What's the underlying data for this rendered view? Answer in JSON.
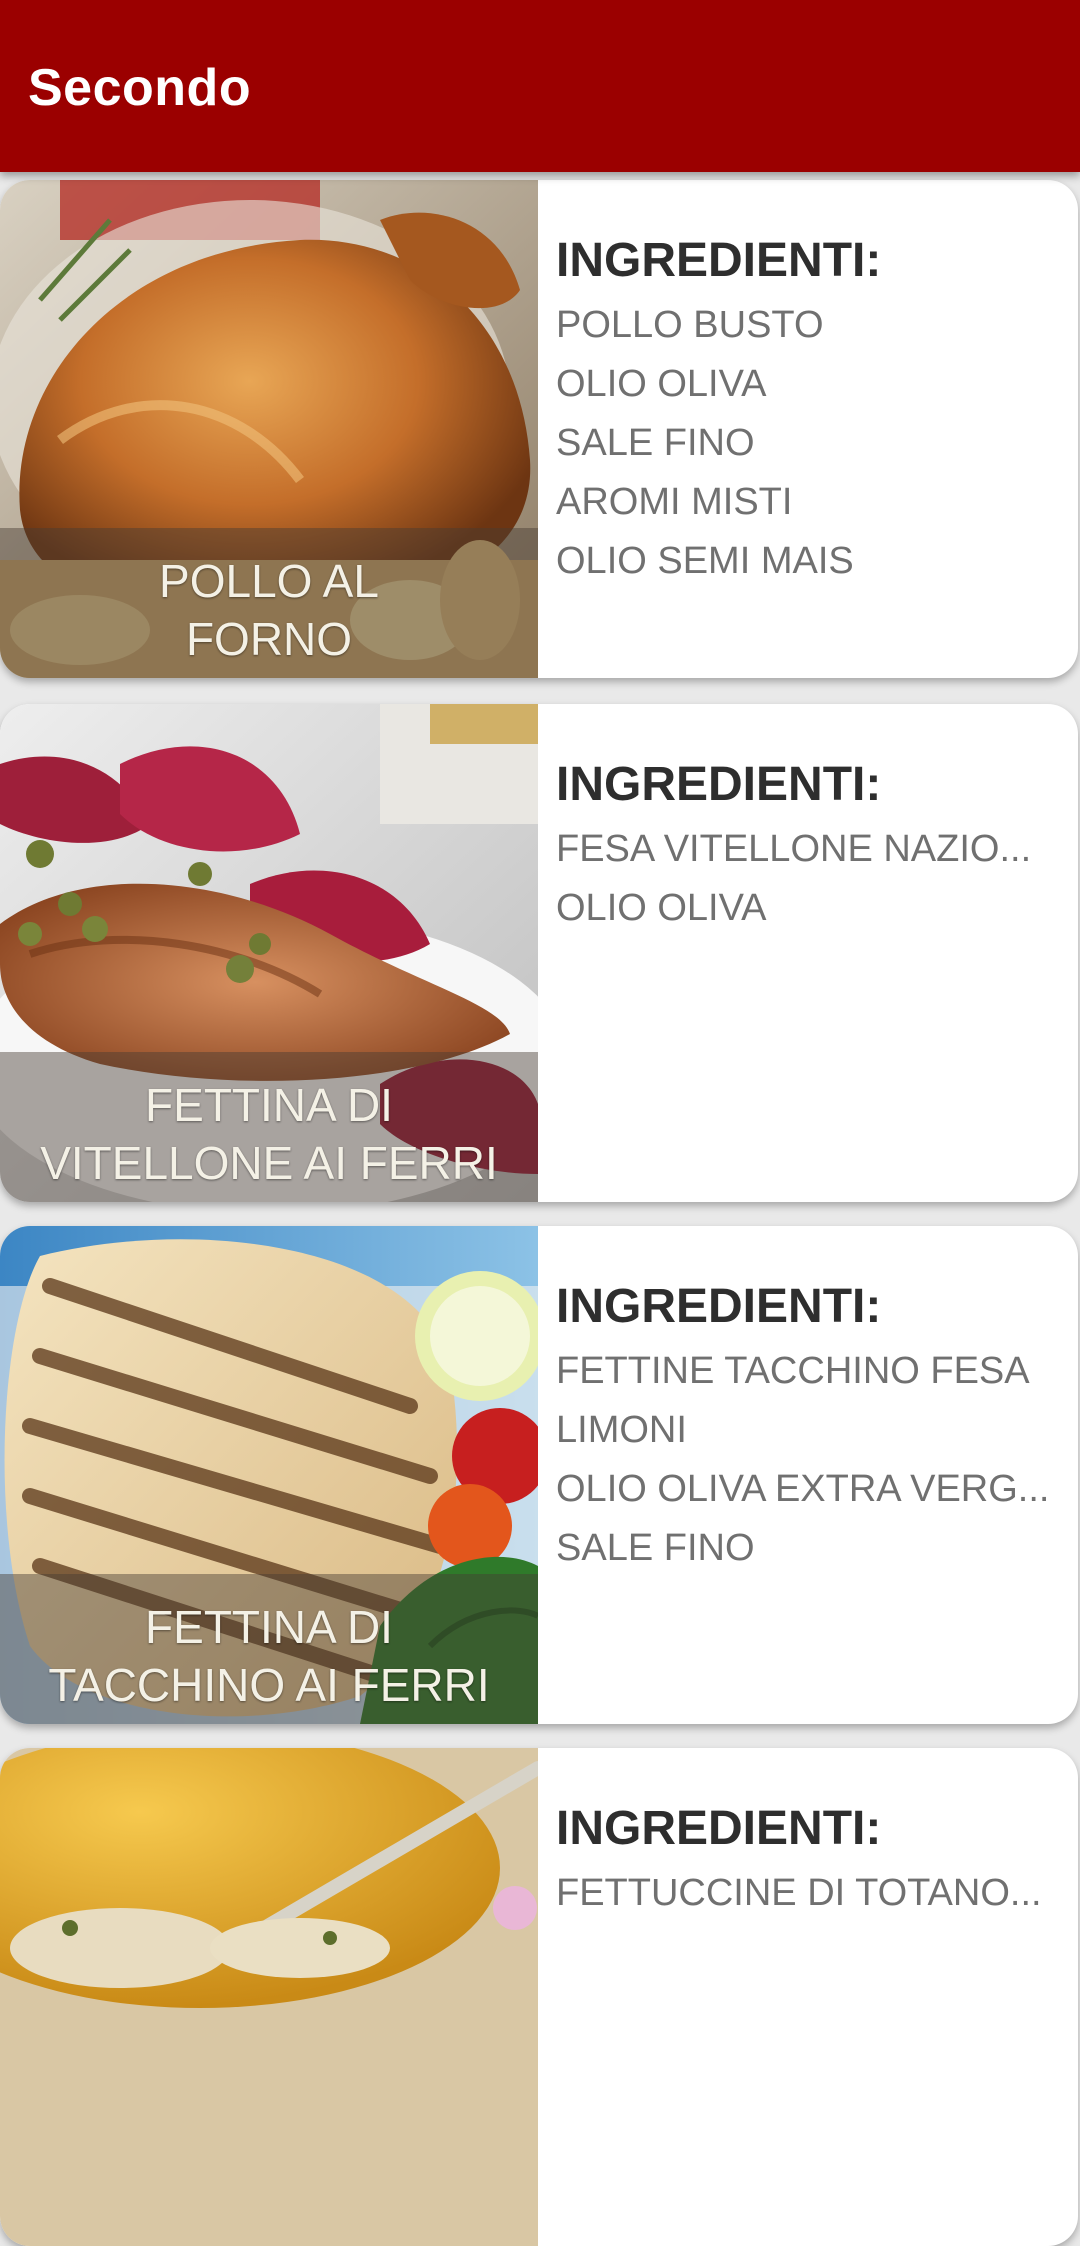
{
  "appbar": {
    "title": "Secondo"
  },
  "recipes": [
    {
      "name_line1": "POLLO AL",
      "name_line2": "FORNO",
      "ingredients_title": "INGREDIENTI:",
      "ingredients": [
        "POLLO BUSTO",
        "OLIO OLIVA",
        "SALE FINO",
        "AROMI MISTI",
        "OLIO SEMI MAIS"
      ]
    },
    {
      "name_line1": "FETTINA DI",
      "name_line2": "VITELLONE AI FERRI",
      "ingredients_title": "INGREDIENTI:",
      "ingredients": [
        "FESA VITELLONE NAZIO...",
        "OLIO OLIVA"
      ]
    },
    {
      "name_line1": "FETTINA DI",
      "name_line2": "TACCHINO AI FERRI",
      "ingredients_title": "INGREDIENTI:",
      "ingredients": [
        "FETTINE TACCHINO FESA",
        "LIMONI",
        "OLIO OLIVA EXTRA VERG...",
        "SALE FINO"
      ]
    },
    {
      "name_line1": "",
      "name_line2": "",
      "ingredients_title": "INGREDIENTI:",
      "ingredients": [
        "FETTUCCINE DI TOTANO..."
      ]
    }
  ],
  "colors": {
    "appbar": "#9b0000",
    "background": "#e9e9e9",
    "card": "#ffffff"
  }
}
